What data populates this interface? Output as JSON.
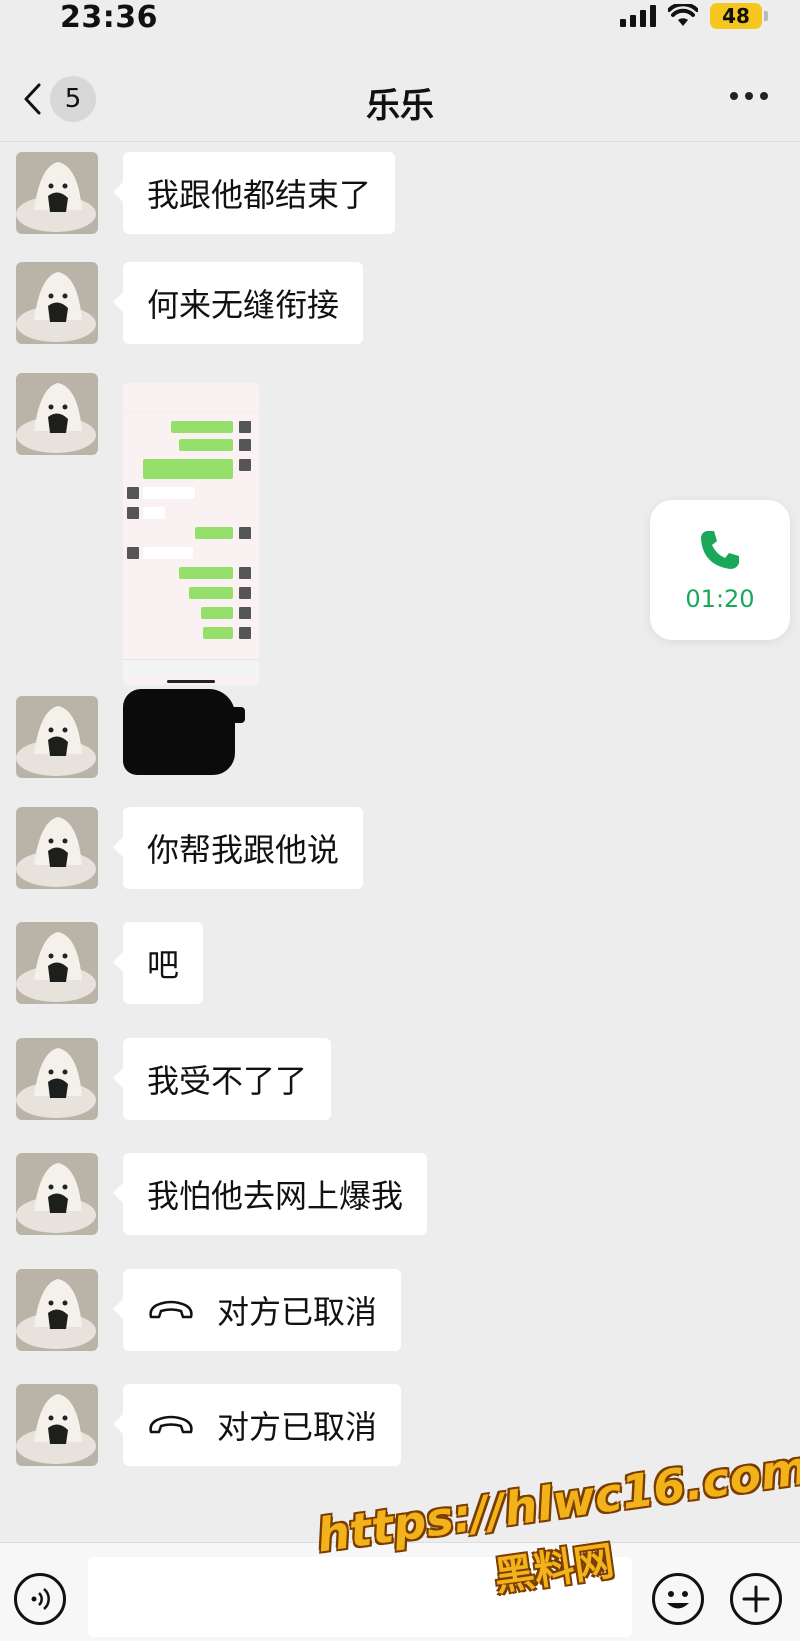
{
  "status_bar": {
    "time": "23:36",
    "battery": "48"
  },
  "header": {
    "back_count": "5",
    "title": "乐乐"
  },
  "messages": [
    {
      "type": "text",
      "text": "我跟他都结束了"
    },
    {
      "type": "text",
      "text": "何来无缝衔接"
    },
    {
      "type": "image",
      "description_icon": "chat-screenshot"
    },
    {
      "type": "sticker",
      "description_icon": "redacted-sticker"
    },
    {
      "type": "text",
      "text": "你帮我跟他说"
    },
    {
      "type": "text",
      "text": "吧"
    },
    {
      "type": "text",
      "text": "我受不了了"
    },
    {
      "type": "text",
      "text": "我怕他去网上爆我"
    },
    {
      "type": "call",
      "text": "对方已取消"
    },
    {
      "type": "call",
      "text": "对方已取消"
    }
  ],
  "floating_call": {
    "duration": "01:20"
  },
  "colors": {
    "background": "#ededed",
    "bubble": "#ffffff",
    "call_green": "#19a85a",
    "watermark": "#f2b21a"
  },
  "watermark": {
    "url": "https://hlwc16.com",
    "name": "黑料网"
  }
}
